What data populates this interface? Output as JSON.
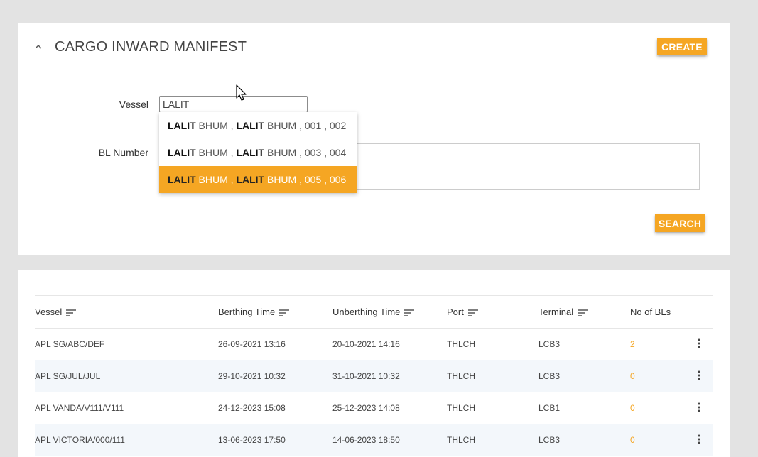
{
  "header": {
    "title": "CARGO INWARD MANIFEST",
    "create_label": "CREATE"
  },
  "form": {
    "vessel_label": "Vessel",
    "vessel_value": "LALIT",
    "bl_label": "BL Number",
    "search_label": "SEARCH"
  },
  "autocomplete": {
    "items": [
      {
        "match1": "LALIT",
        "rest1": " BHUM , ",
        "match2": "LALIT",
        "rest2": " BHUM , 001 , 002"
      },
      {
        "match1": "LALIT",
        "rest1": " BHUM , ",
        "match2": "LALIT",
        "rest2": " BHUM , 003 , 004"
      },
      {
        "match1": "LALIT",
        "rest1": " BHUM , ",
        "match2": "LALIT",
        "rest2": " BHUM , 005 , 006"
      }
    ],
    "selected_index": 2
  },
  "table": {
    "headers": [
      "Vessel",
      "Berthing Time",
      "Unberthing Time",
      "Port",
      "Terminal",
      "No of BLs"
    ],
    "rows": [
      [
        "APL SG/ABC/DEF",
        "26-09-2021 13:16",
        "20-10-2021 14:16",
        "THLCH",
        "LCB3",
        "2"
      ],
      [
        "APL SG/JUL/JUL",
        "29-10-2021 10:32",
        "31-10-2021 10:32",
        "THLCH",
        "LCB3",
        "0"
      ],
      [
        "APL VANDA/V111/V111",
        "24-12-2023 15:08",
        "25-12-2023 14:08",
        "THLCH",
        "LCB1",
        "0"
      ],
      [
        "APL VICTORIA/000/111",
        "13-06-2023 17:50",
        "14-06-2023 18:50",
        "THLCH",
        "LCB3",
        "0"
      ]
    ]
  },
  "colors": {
    "accent": "#f5a623",
    "row_alt": "#f3f7fb"
  }
}
